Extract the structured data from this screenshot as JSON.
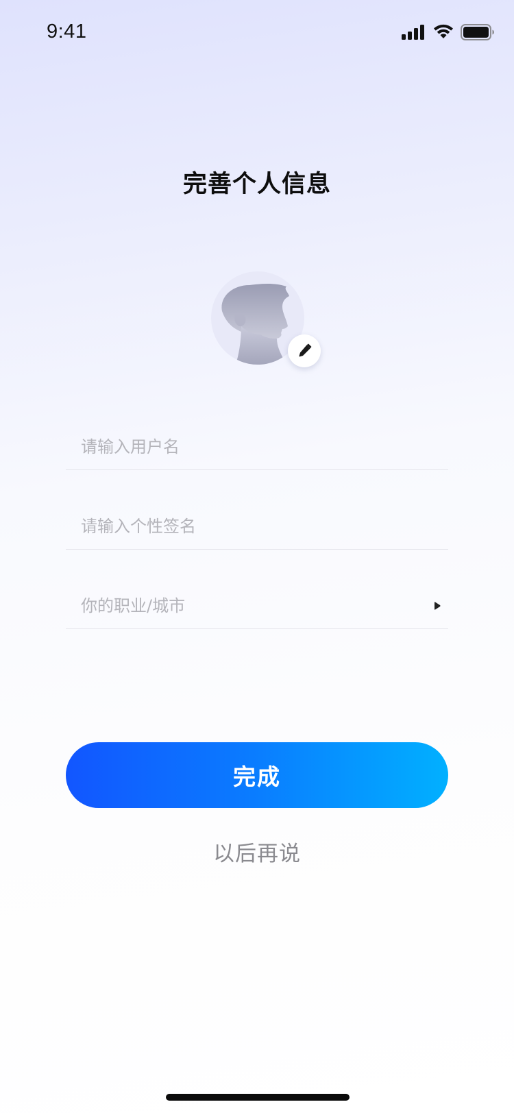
{
  "status_bar": {
    "time": "9:41",
    "icons": [
      "signal-icon",
      "wifi-icon",
      "battery-icon"
    ]
  },
  "page": {
    "title": "完善个人信息"
  },
  "avatar": {
    "icon": "person-silhouette-icon",
    "edit_icon": "pencil-icon"
  },
  "form": {
    "username_placeholder": "请输入用户名",
    "signature_placeholder": "请输入个性签名",
    "job_city_placeholder": "你的职业/城市",
    "job_city_icon": "arrow-right-icon"
  },
  "actions": {
    "done_label": "完成",
    "later_label": "以后再说"
  },
  "colors": {
    "primary_gradient_start": "#1256ff",
    "primary_gradient_end": "#01b0ff",
    "placeholder": "#b4b4ba",
    "secondary_text": "#8a8a8f"
  }
}
